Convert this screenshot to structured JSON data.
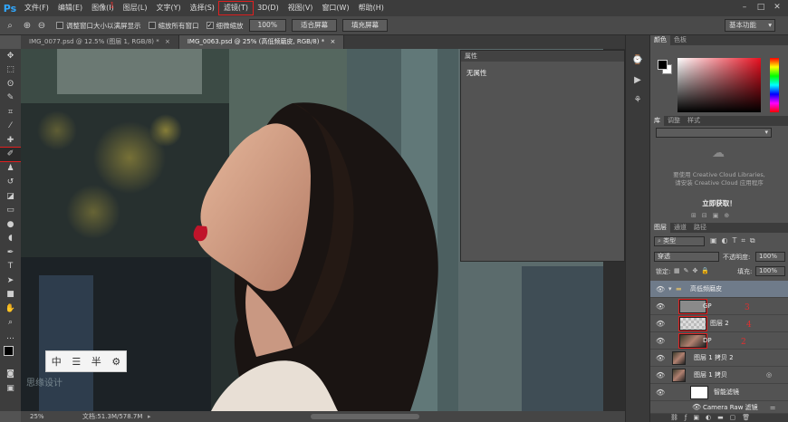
{
  "app": {
    "logo": "Ps"
  },
  "menu": [
    {
      "label": "文件(F)",
      "highlight": false
    },
    {
      "label": "编辑(E)",
      "highlight": false
    },
    {
      "label": "图像(I)",
      "highlight": false
    },
    {
      "label": "图层(L)",
      "highlight": false
    },
    {
      "label": "文字(Y)",
      "highlight": false
    },
    {
      "label": "选择(S)",
      "highlight": false
    },
    {
      "label": "滤镜(T)",
      "highlight": true
    },
    {
      "label": "3D(D)",
      "highlight": false
    },
    {
      "label": "视图(V)",
      "highlight": false
    },
    {
      "label": "窗口(W)",
      "highlight": false
    },
    {
      "label": "帮助(H)",
      "highlight": false
    }
  ],
  "window_controls": {
    "minimize": "–",
    "maximize": "□",
    "close": "✕"
  },
  "options": {
    "resize_window": "调整窗口大小以满屏显示",
    "zoom_all": "缩放所有窗口",
    "scrubby_zoom": "细微缩放",
    "zoom_100": "100%",
    "fit_screen": "适合屏幕",
    "fill_screen": "填充屏幕",
    "workspace": "基本功能"
  },
  "tabs": [
    {
      "label": "IMG_0077.psd @ 12.5% (图层 1, RGB/8) *",
      "active": false
    },
    {
      "label": "IMG_0063.psd @ 25% (高低频磨皮, RGB/8) *",
      "active": true
    }
  ],
  "properties": {
    "title": "属性",
    "content": "无属性"
  },
  "overlay_tools": [
    "中",
    "☰",
    "半",
    "⚙"
  ],
  "watermark": "思缘设计",
  "status": {
    "zoom": "25%",
    "doc": "文档:51.3M/578.7M"
  },
  "annotations": {
    "tool_brush": "4",
    "gp": "3",
    "layer2": "4",
    "dp": "2",
    "menu_num": "1"
  },
  "color_panel": {
    "tabs": [
      "颜色",
      "色板"
    ]
  },
  "library_panel": {
    "tabs": [
      "库",
      "调整",
      "样式"
    ],
    "message_line1": "要使用 Creative Cloud Libraries,",
    "message_line2": "请安装 Creative Cloud 应用程序",
    "action": "立即获取！"
  },
  "layers_panel": {
    "tabs": [
      "图层",
      "通道",
      "路径"
    ],
    "filter_kind": "类型",
    "blend_mode": "穿透",
    "opacity_label": "不透明度:",
    "opacity": "100%",
    "lock_label": "锁定:",
    "fill_label": "填充:",
    "fill": "100%",
    "layers": [
      {
        "name": "高低频磨皮",
        "kind": "group"
      },
      {
        "name": "GP",
        "kind": "gray"
      },
      {
        "name": "图层 2",
        "kind": "checker"
      },
      {
        "name": "DP",
        "kind": "photo"
      },
      {
        "name": "图层 1 拷贝 2",
        "kind": "photo"
      },
      {
        "name": "图层 1 拷贝",
        "kind": "photo"
      },
      {
        "name": "智能滤镜",
        "kind": "white"
      },
      {
        "name": "Camera Raw 滤镜",
        "kind": "filter"
      }
    ]
  },
  "colors": {
    "accent": "#31a8ff",
    "annotation": "#e02020"
  }
}
